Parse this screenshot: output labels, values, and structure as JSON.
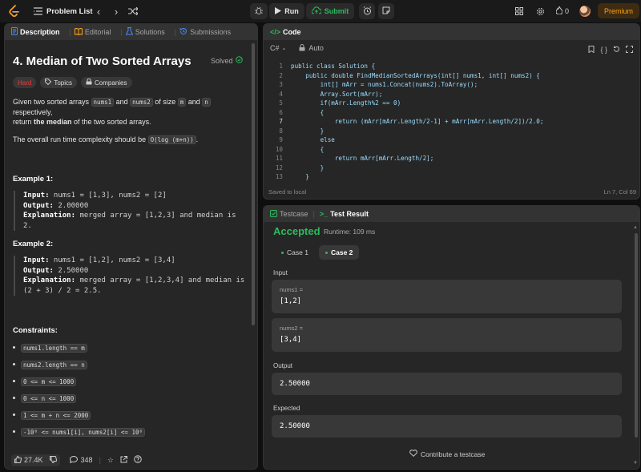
{
  "topbar": {
    "problem_list": "Problem List",
    "run": "Run",
    "submit": "Submit",
    "streak": "0",
    "premium": "Premium"
  },
  "left_tabs": [
    "Description",
    "Editorial",
    "Solutions",
    "Submissions"
  ],
  "problem": {
    "title": "4. Median of Two Sorted Arrays",
    "solved": "Solved",
    "difficulty": "Hard",
    "topics": "Topics",
    "companies": "Companies",
    "stmt_1": "Given two sorted arrays ",
    "stmt_nums1": "nums1",
    "stmt_and": " and ",
    "stmt_nums2": "nums2",
    "stmt_size": " of size ",
    "stmt_m": "m",
    "stmt_n": "n",
    "stmt_resp": " respectively,",
    "stmt_return": "return ",
    "stmt_median": "the median",
    "stmt_of": " of the two sorted arrays.",
    "complexity_pre": "The overall run time complexity should be ",
    "complexity_code": "O(log (m+n))",
    "complexity_post": ".",
    "examples": [
      {
        "heading": "Example 1:",
        "input_label": "Input:",
        "input": " nums1 = [1,3], nums2 = [2]",
        "output_label": "Output:",
        "output": " 2.00000",
        "explanation_label": "Explanation:",
        "explanation": " merged array = [1,2,3] and median is",
        "explanation_2": "2."
      },
      {
        "heading": "Example 2:",
        "input_label": "Input:",
        "input": " nums1 = [1,2], nums2 = [3,4]",
        "output_label": "Output:",
        "output": " 2.50000",
        "explanation_label": "Explanation:",
        "explanation": " merged array = [1,2,3,4] and median is",
        "explanation_2": "(2 + 3) / 2 = 2.5."
      }
    ],
    "constraints_heading": "Constraints:",
    "constraints": [
      "nums1.length == m",
      "nums2.length == n",
      "0 <= m <= 1000",
      "0 <= n <= 1000",
      "1 <= m + n <= 2000",
      "-10⁶ <= nums1[i], nums2[i] <= 10⁶"
    ],
    "likes": "27.4K",
    "comments": "348"
  },
  "code": {
    "header": "Code",
    "language": "C#",
    "mode": "Auto",
    "saved": "Saved to local",
    "cursor": "Ln 7, Col 69",
    "lines": [
      "public class Solution {",
      "    public double FindMedianSortedArrays(int[] nums1, int[] nums2) {",
      "        int[] mArr = nums1.Concat(nums2).ToArray();",
      "        Array.Sort(mArr);",
      "        if(mArr.Length%2 == 0)",
      "        {",
      "            return (mArr[mArr.Length/2-1] + mArr[mArr.Length/2])/2.0;",
      "        }",
      "        else",
      "        {",
      "            return mArr[mArr.Length/2];",
      "        }",
      "    }"
    ]
  },
  "test": {
    "tab_testcase": "Testcase",
    "tab_result": "Test Result",
    "status": "Accepted",
    "runtime": "Runtime: 109 ms",
    "cases": [
      "Case 1",
      "Case 2"
    ],
    "input_label": "Input",
    "nums1_label": "nums1 =",
    "nums1_value": "[1,2]",
    "nums2_label": "nums2 =",
    "nums2_value": "[3,4]",
    "output_label": "Output",
    "output_value": "2.50000",
    "expected_label": "Expected",
    "expected_value": "2.50000",
    "contribute": "Contribute a testcase"
  },
  "colors": {
    "accent": "#ffa116",
    "success": "#2cbb5d",
    "hard": "#f63636",
    "panel": "#262626",
    "background": "#0f0f0f"
  }
}
